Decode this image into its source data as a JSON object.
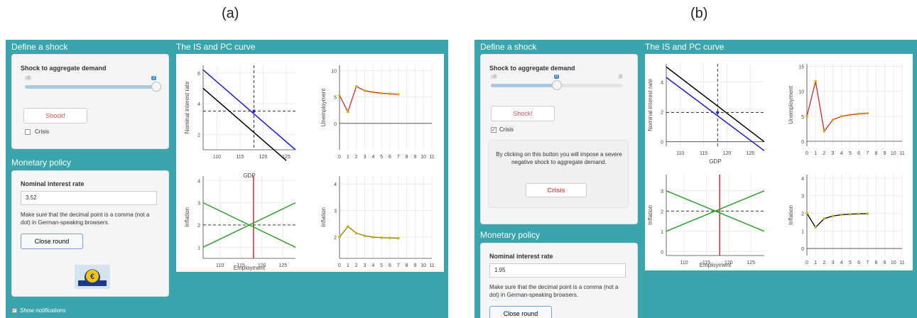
{
  "labels": {
    "a": "(a)",
    "b": "(b)"
  },
  "a": {
    "define_title": "Define a shock",
    "shock_label": "Shock to aggregate demand",
    "slider_min": "-2",
    "slider_value": "2",
    "slider_fraction": 1.0,
    "shock_button": "Shock!",
    "crisis_label": "Crisis",
    "crisis_checked": "",
    "monetary_title": "Monetary policy",
    "rate_label": "Nominal interest rate",
    "rate_value": "3.52",
    "note": "Make sure that the decimal point is a comma (not a dot) in German-speaking browsers.",
    "close_button": "Close round",
    "notifications_label": "Show notifications",
    "plots_title": "The IS and PC curve",
    "gdp_label": "GDP",
    "employment_label": "Employment",
    "ylabel_rate": "Nominal interest rate",
    "ylabel_unemp": "Unemployment",
    "ylabel_infl": "Inflation"
  },
  "b": {
    "define_title": "Define a shock",
    "shock_label": "Shock to aggregate demand",
    "slider_min": "-2",
    "slider_value": "0",
    "slider_max": "2",
    "slider_fraction": 0.5,
    "shock_button": "Shock!",
    "crisis_label": "Crisis",
    "crisis_checked": "✓",
    "crisis_text": "By clicking on this button you will impose a severe negative shock to aggregate demand.",
    "crisis_button": "Crisis",
    "monetary_title": "Monetary policy",
    "rate_label": "Nominal interest rate",
    "rate_value": "1.95",
    "note": "Make sure that the decimal point is a comma (not a dot) in German-speaking browsers.",
    "close_button": "Close round",
    "plots_title": "The IS and PC curve",
    "gdp_label": "GDP",
    "employment_label": "Employment",
    "ylabel_rate": "Nominal interest rate",
    "ylabel_unemp": "Unemployment",
    "ylabel_infl": "Inflation"
  },
  "chart_data": [
    {
      "type": "line",
      "panel": "a",
      "xlabel": "GDP",
      "ylabel": "Nominal interest rate",
      "xticks": [
        "110",
        "115",
        "120",
        "125"
      ],
      "yticks": [
        "2",
        "4",
        "6"
      ],
      "series": [
        {
          "color": "#1a1ad6",
          "x": [
            107,
            127
          ],
          "y": [
            6.2,
            1.0
          ]
        },
        {
          "color": "#000000",
          "x": [
            107,
            125
          ],
          "y": [
            5.0,
            0.3
          ]
        }
      ],
      "refs": {
        "x": 118,
        "y": 3.52
      }
    },
    {
      "type": "line",
      "panel": "a",
      "ylabel": "Unemployment",
      "xticks": [
        "0",
        "1",
        "2",
        "3",
        "4",
        "5",
        "6",
        "7",
        "8",
        "9",
        "10",
        "11"
      ],
      "yticks": [
        "0",
        "5",
        "10"
      ],
      "series": [
        {
          "color": "#d62728",
          "x": [
            0,
            1,
            2,
            3,
            4,
            5,
            6,
            7
          ],
          "y": [
            5.3,
            2.2,
            7.0,
            6.2,
            5.9,
            5.7,
            5.6,
            5.5
          ]
        }
      ]
    },
    {
      "type": "line",
      "panel": "a",
      "xlabel": "Employment",
      "ylabel": "Inflation",
      "xticks": [
        "110",
        "115",
        "120",
        "125"
      ],
      "yticks": [
        "1",
        "2",
        "3",
        "4"
      ],
      "series": [
        {
          "color": "#2ca02c",
          "x": [
            106,
            128
          ],
          "y": [
            1.0,
            3.0
          ]
        },
        {
          "color": "#2ca02c",
          "x": [
            106,
            128
          ],
          "y": [
            3.0,
            1.0
          ]
        }
      ],
      "refs": {
        "x": 118,
        "y": 2
      }
    },
    {
      "type": "line",
      "panel": "a",
      "ylabel": "Inflation",
      "xticks": [
        "0",
        "1",
        "2",
        "3",
        "4",
        "5",
        "6",
        "7",
        "8",
        "9",
        "10",
        "11"
      ],
      "yticks": [
        "2",
        "3",
        "4"
      ],
      "series": [
        {
          "color": "#888800",
          "x": [
            0,
            1,
            2,
            3,
            4,
            5,
            6,
            7
          ],
          "y": [
            2.0,
            2.4,
            2.15,
            2.05,
            2.0,
            1.98,
            1.97,
            1.96
          ]
        }
      ]
    },
    {
      "type": "line",
      "panel": "b",
      "xlabel": "GDP",
      "ylabel": "Nominal interest rate",
      "xticks": [
        "110",
        "115",
        "120",
        "125"
      ],
      "yticks": [
        "0",
        "2",
        "4"
      ],
      "series": [
        {
          "color": "#000000",
          "x": [
            107,
            128
          ],
          "y": [
            5.0,
            0.0
          ]
        },
        {
          "color": "#1a1ad6",
          "x": [
            107,
            128
          ],
          "y": [
            4.3,
            -0.6
          ]
        }
      ],
      "refs": {
        "x": 118,
        "y": 1.95
      }
    },
    {
      "type": "line",
      "panel": "b",
      "ylabel": "Unemployment",
      "xticks": [
        "0",
        "1",
        "2",
        "3",
        "4",
        "5",
        "6",
        "7",
        "8",
        "9",
        "10",
        "11"
      ],
      "yticks": [
        "0",
        "5",
        "10",
        "15"
      ],
      "series": [
        {
          "color": "#d62728",
          "x": [
            0,
            1,
            2,
            3,
            4,
            5,
            6,
            7
          ],
          "y": [
            5.0,
            12.0,
            2.0,
            4.3,
            5.0,
            5.3,
            5.5,
            5.6
          ]
        }
      ]
    },
    {
      "type": "line",
      "panel": "b",
      "xlabel": "Employment",
      "ylabel": "Inflation",
      "xticks": [
        "110",
        "115",
        "120",
        "125"
      ],
      "yticks": [
        "0",
        "1",
        "2",
        "3"
      ],
      "series": [
        {
          "color": "#2ca02c",
          "x": [
            106,
            128
          ],
          "y": [
            1.0,
            3.0
          ]
        },
        {
          "color": "#2ca02c",
          "x": [
            106,
            128
          ],
          "y": [
            3.0,
            1.0
          ]
        }
      ],
      "refs": {
        "x": 118,
        "y": 2
      }
    },
    {
      "type": "line",
      "panel": "b",
      "ylabel": "Inflation",
      "xticks": [
        "0",
        "1",
        "2",
        "3",
        "4",
        "5",
        "6",
        "7",
        "8",
        "9",
        "10",
        "11"
      ],
      "yticks": [
        "0",
        "1",
        "2",
        "3",
        "4"
      ],
      "series": [
        {
          "color": "#000000",
          "x": [
            0,
            1,
            2,
            3,
            4,
            5,
            6,
            7
          ],
          "y": [
            2.0,
            1.2,
            1.7,
            1.85,
            1.92,
            1.95,
            1.97,
            1.98
          ]
        }
      ]
    }
  ]
}
